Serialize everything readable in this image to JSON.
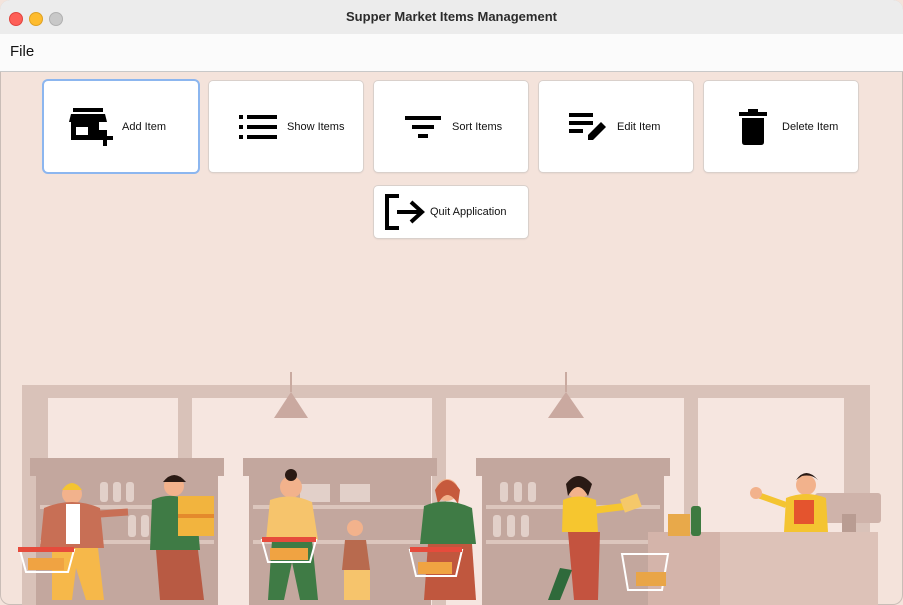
{
  "window": {
    "title": "Supper Market Items Management"
  },
  "menubar": {
    "file": "File"
  },
  "buttons": {
    "add": {
      "label": "Add Item",
      "icon": "add-store-icon"
    },
    "show": {
      "label": "Show Items",
      "icon": "list-icon"
    },
    "sort": {
      "label": "Sort Items",
      "icon": "filter-sort-icon"
    },
    "edit": {
      "label": "Edit Item",
      "icon": "edit-list-icon"
    },
    "delete": {
      "label": "Delete Item",
      "icon": "trash-icon"
    },
    "quit": {
      "label": "Quit Application",
      "icon": "logout-icon"
    }
  },
  "illustration": {
    "name": "supermarket-shoppers-illustration"
  },
  "colors": {
    "background": "#f4e3db",
    "focus_ring": "#8cb6ef",
    "store_wall": "#d6bfb6"
  }
}
